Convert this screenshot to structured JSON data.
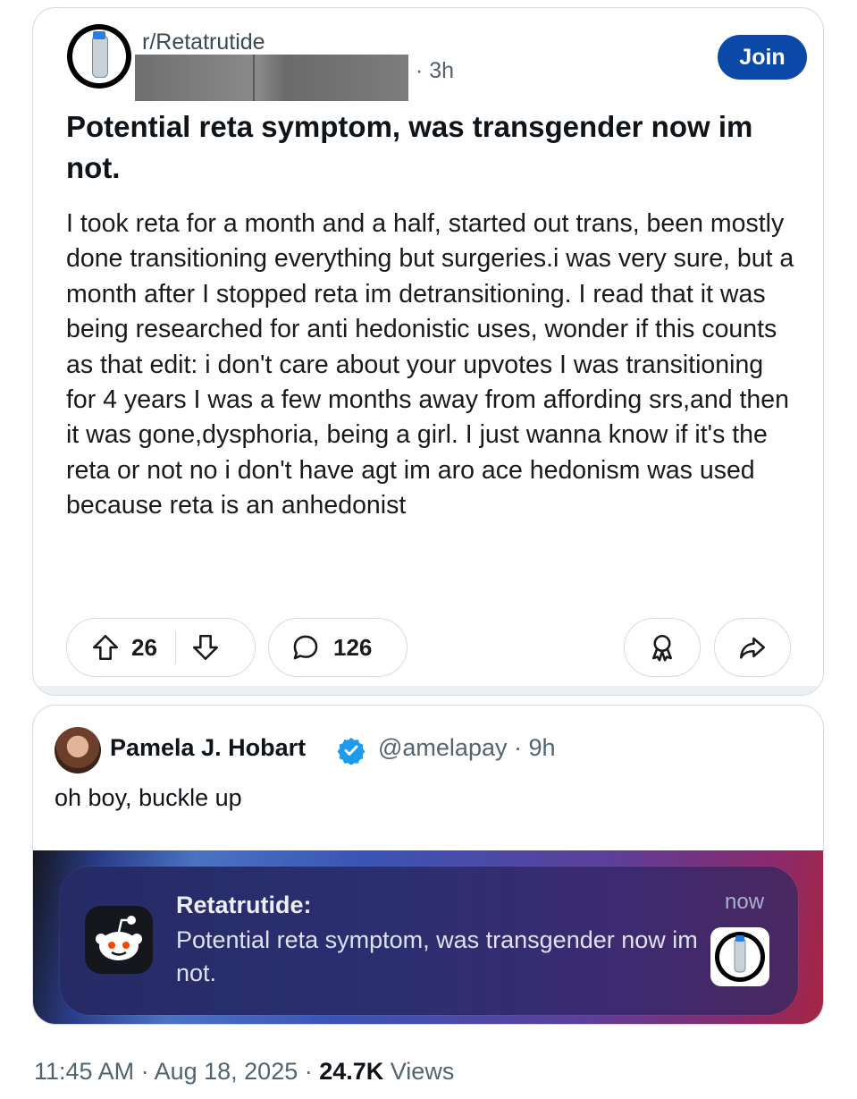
{
  "reddit_post": {
    "subreddit": "r/Retatrutide",
    "age": "· 3h",
    "join_label": "Join",
    "title": "Potential reta symptom, was transgender now im not.",
    "body": "I took reta for a month and a half, started out trans, been mostly done transitioning everything but surgeries.i was very sure, but a month after I stopped reta im detransitioning. I read that it was being researched for anti hedonistic uses, wonder if this counts as that edit: i don't care about your upvotes I was transitioning for 4 years I was a few months away from affording srs,and then it was gone,dysphoria, being a girl. I just wanna know if it's the reta or not no i don't have agt im aro ace hedonism was used because reta is an anhedonist",
    "upvotes": "26",
    "comments": "126",
    "icons": [
      "upvote-icon",
      "downvote-icon",
      "comment-icon",
      "award-icon",
      "share-icon"
    ]
  },
  "tweet": {
    "name": "Pamela J. Hobart",
    "handle": "@amelapay · 9h",
    "text": "oh boy, buckle up",
    "verified_color": "#1d9bf0"
  },
  "notification": {
    "app": "Retatrutide:",
    "message": "Potential reta symptom, was transgender now im not.",
    "time": "now"
  },
  "footer": {
    "time": "11:45 AM · Aug 18, 2025 · ",
    "views_count": "24.7K",
    "views_label": " Views"
  }
}
